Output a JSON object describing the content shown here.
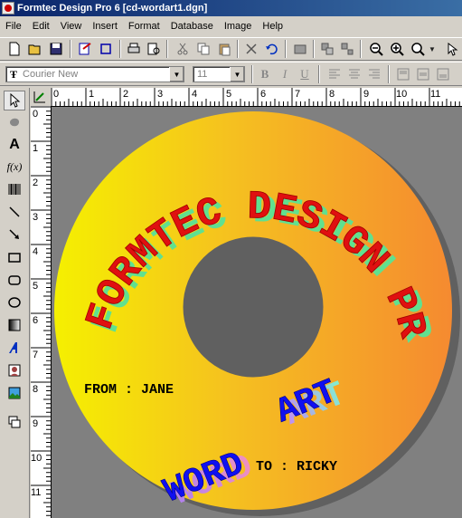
{
  "window": {
    "title": "Formtec Design Pro 6 [cd-wordart1.dgn]"
  },
  "menu": [
    "File",
    "Edit",
    "View",
    "Insert",
    "Format",
    "Database",
    "Image",
    "Help"
  ],
  "format_bar": {
    "font_name": "Courier New",
    "font_size": "11"
  },
  "ruler": {
    "h_labels": [
      "0",
      "1",
      "2",
      "3",
      "4",
      "5",
      "6",
      "7",
      "8",
      "9",
      "10",
      "11"
    ],
    "v_labels": [
      "0",
      "1",
      "2",
      "3",
      "4",
      "5",
      "6",
      "7",
      "8",
      "9",
      "10",
      "11"
    ]
  },
  "cd_label": {
    "arc_text": "FORMTEC DESIGN PRO",
    "word_art_1": "WORD",
    "word_art_2": "ART",
    "from_text": "FROM : JANE",
    "to_text": "TO : RICKY"
  },
  "colors": {
    "title_gradient_start": "#0a246a",
    "disc_gradient_left": "#f5f000",
    "disc_gradient_right": "#f58a30",
    "arc_text_color": "#e01010",
    "word_art_color": "#1010f0",
    "shadow_green": "#60e090",
    "shadow_pink": "#e080d0"
  }
}
